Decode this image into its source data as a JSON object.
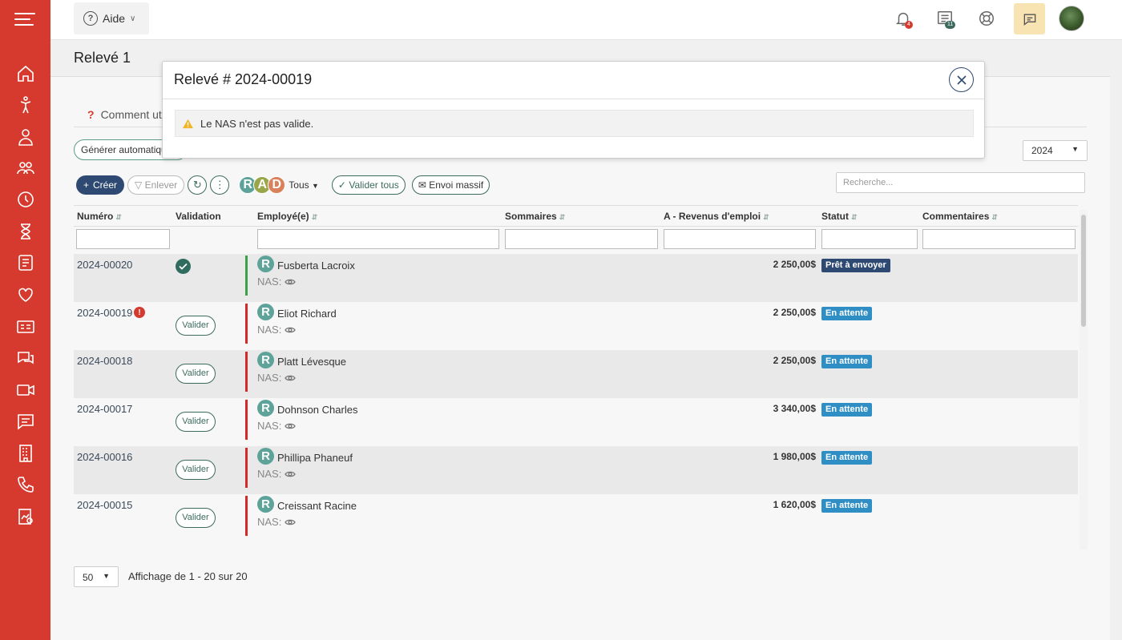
{
  "topbar": {
    "help_label": "Aide",
    "notif_badge": "4",
    "calendar_badge": "11"
  },
  "page": {
    "title": "Relevé 1",
    "howto_label": "Comment util",
    "generate_label": "Générer automatique",
    "year": "2024"
  },
  "toolbar": {
    "create_label": "Créer",
    "remove_label": "Enlever",
    "rad_letters": [
      "R",
      "A",
      "D"
    ],
    "filter_label": "Tous",
    "validate_all_label": "Valider tous",
    "mass_send_label": "Envoi massif",
    "search_placeholder": "Recherche..."
  },
  "table": {
    "headers": {
      "numero": "Numéro",
      "validation": "Validation",
      "employe": "Employé(e)",
      "sommaires": "Sommaires",
      "revenus": "A - Revenus d'emploi",
      "statut": "Statut",
      "commentaires": "Commentaires"
    },
    "nas_label": "NAS:",
    "validate_label": "Valider",
    "rows": [
      {
        "numero": "2024-00020",
        "employe": "Fusberta Lacroix",
        "montant": "2 250,00$",
        "statut": "Prêt à envoyer",
        "valid": true,
        "error": false
      },
      {
        "numero": "2024-00019",
        "employe": "Eliot Richard",
        "montant": "2 250,00$",
        "statut": "En attente",
        "valid": false,
        "error": true
      },
      {
        "numero": "2024-00018",
        "employe": "Platt Lévesque",
        "montant": "2 250,00$",
        "statut": "En attente",
        "valid": false,
        "error": false
      },
      {
        "numero": "2024-00017",
        "employe": "Dohnson Charles",
        "montant": "3 340,00$",
        "statut": "En attente",
        "valid": false,
        "error": false
      },
      {
        "numero": "2024-00016",
        "employe": "Phillipa Phaneuf",
        "montant": "1 980,00$",
        "statut": "En attente",
        "valid": false,
        "error": false
      },
      {
        "numero": "2024-00015",
        "employe": "Creissant Racine",
        "montant": "1 620,00$",
        "statut": "En attente",
        "valid": false,
        "error": false
      }
    ]
  },
  "footer": {
    "page_size": "50",
    "summary": "Affichage de 1 - 20 sur 20"
  },
  "modal": {
    "title": "Relevé # 2024-00019",
    "alert": "Le NAS n'est pas valide."
  },
  "colors": {
    "sidebar": "#d63a2f",
    "primary": "#2e4a72",
    "teal": "#3c6a5e",
    "status_ready": "#2e4a72",
    "status_pending": "#2f8fc4",
    "bar_valid": "#3aa04a",
    "bar_invalid": "#d62828"
  }
}
